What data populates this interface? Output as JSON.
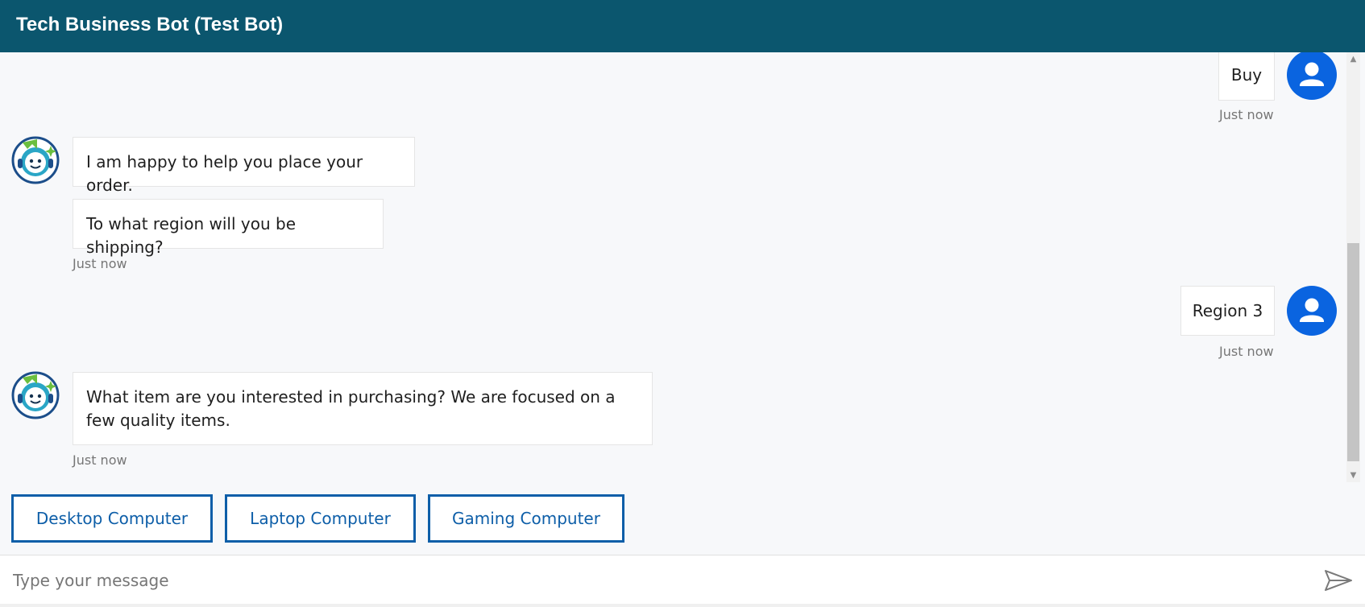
{
  "header": {
    "title": "Tech Business Bot (Test Bot)"
  },
  "messages": [
    {
      "from": "user",
      "text": "Buy",
      "time": "Just now"
    },
    {
      "from": "bot",
      "texts": [
        "I am happy to help you place your order.",
        "To what region will you be shipping?"
      ],
      "time": "Just now"
    },
    {
      "from": "user",
      "text": "Region 3",
      "time": "Just now"
    },
    {
      "from": "bot",
      "texts": [
        "What item are you interested in purchasing? We are focused on a few quality items."
      ],
      "time": "Just now"
    }
  ],
  "suggested_actions": [
    "Desktop Computer",
    "Laptop Computer",
    "Gaming Computer"
  ],
  "composer": {
    "placeholder": "Type your message"
  },
  "icons": {
    "user_avatar": "user-avatar-icon",
    "bot_avatar": "bot-avatar-icon",
    "send": "send-icon"
  },
  "colors": {
    "header_bg": "#0b566e",
    "user_avatar_bg": "#0a64e0",
    "action_border": "#0d5ea8",
    "chat_bg": "#f7f8fa"
  }
}
